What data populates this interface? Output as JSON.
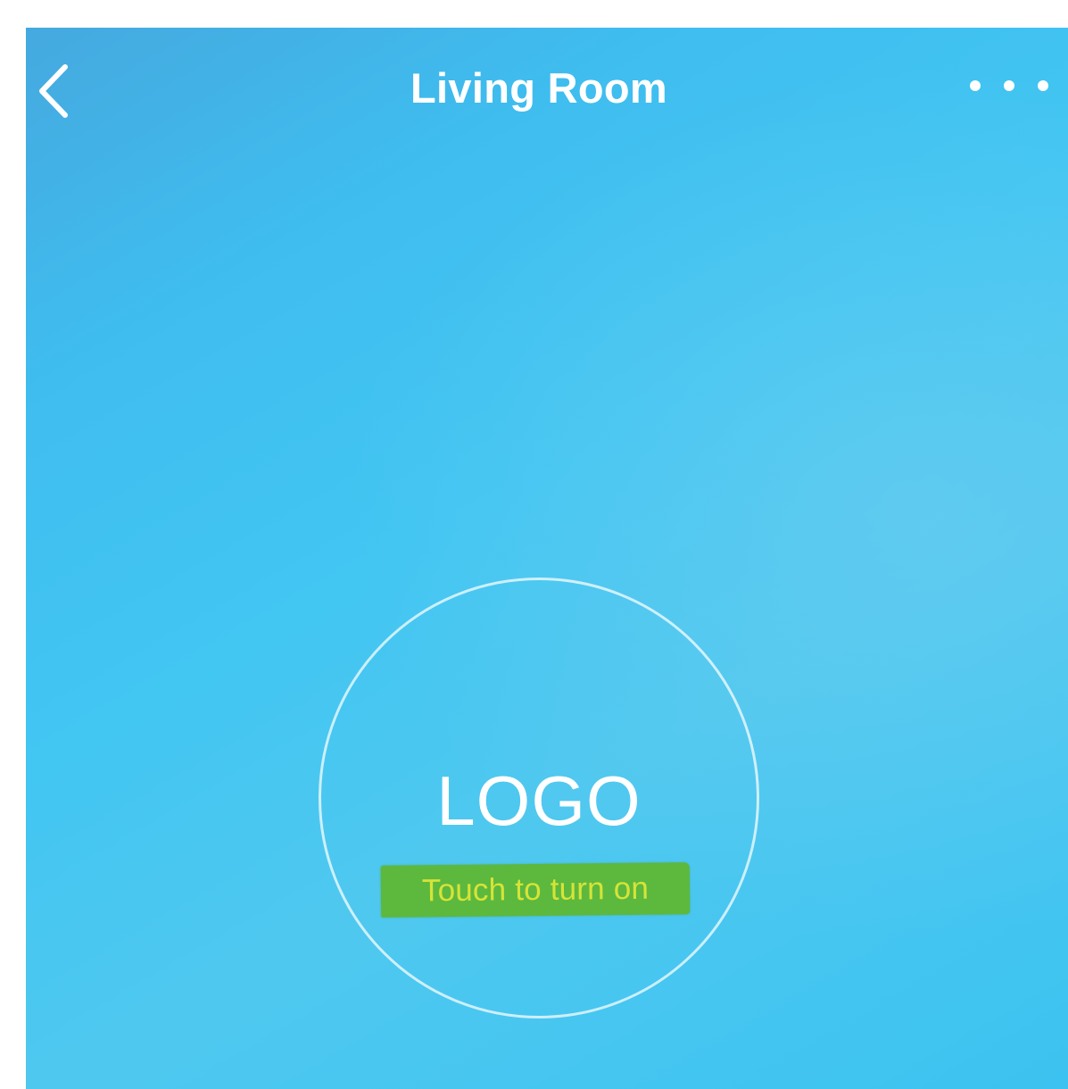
{
  "nav": {
    "title": "Living Room",
    "back_icon": "chevron-left-icon",
    "more_icon": "more-horizontal-icon"
  },
  "device": {
    "logo_text": "LOGO",
    "hint_text": "Touch to turn on"
  },
  "colors": {
    "background_primary": "#42c6f2",
    "background_dark": "#45a9df",
    "text": "#ffffff",
    "hint_highlight": "#5db83e",
    "hint_text": "#d6e437"
  }
}
